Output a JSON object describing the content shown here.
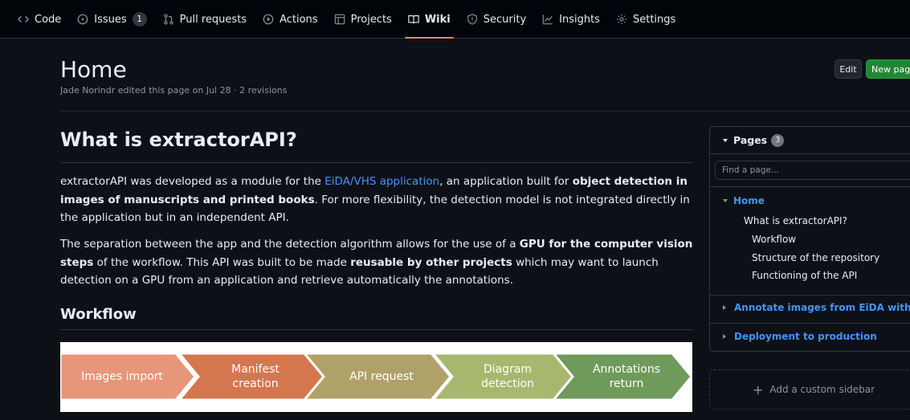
{
  "nav": {
    "tabs": [
      {
        "label": "Code",
        "icon": "code-icon"
      },
      {
        "label": "Issues",
        "icon": "issue-icon",
        "count": "1"
      },
      {
        "label": "Pull requests",
        "icon": "pull-request-icon"
      },
      {
        "label": "Actions",
        "icon": "play-icon"
      },
      {
        "label": "Projects",
        "icon": "table-icon"
      },
      {
        "label": "Wiki",
        "icon": "book-icon",
        "active": true
      },
      {
        "label": "Security",
        "icon": "shield-icon"
      },
      {
        "label": "Insights",
        "icon": "graph-icon"
      },
      {
        "label": "Settings",
        "icon": "gear-icon"
      }
    ]
  },
  "header": {
    "title": "Home",
    "meta": "Jade Norindr edited this page on Jul 28 · 2 revisions",
    "edit_label": "Edit",
    "new_page_label": "New page"
  },
  "article": {
    "h1": "What is extractorAPI?",
    "p1": {
      "t1": "extractorAPI was developed as a module for the ",
      "link": "EiDA/VHS application",
      "t2": ", an application built for ",
      "b1": "object detection in images of manuscripts and printed books",
      "t3": ". For more flexibility, the detection model is not integrated directly in the application but in an independent API."
    },
    "p2": {
      "t1": "The separation between the app and the detection algorithm allows for the use of a ",
      "b1": "GPU for the computer vision steps",
      "t2": " of the workflow. This API was built to be made ",
      "b2": "reusable by other projects",
      "t3": " which may want to launch detection on a GPU from an application and retrieve automatically the annotations."
    },
    "h2": "Workflow",
    "workflow": {
      "steps": [
        {
          "label": "Images import",
          "color": "#e8967a"
        },
        {
          "label": "Manifest creation",
          "color": "#d4774f"
        },
        {
          "label": "API request",
          "color": "#b0a169"
        },
        {
          "label": "Diagram detection",
          "color": "#a8b76e"
        },
        {
          "label": "Annotations return",
          "color": "#6f9a5b"
        }
      ]
    }
  },
  "sidebar": {
    "pages_label": "Pages",
    "pages_count": "3",
    "find_placeholder": "Find a page...",
    "home_label": "Home",
    "toc": [
      "What is extractorAPI?",
      "Workflow",
      "Structure of the repository",
      "Functioning of the API"
    ],
    "other_pages": [
      "Annotate images from EiDA with ...",
      "Deployment to production"
    ],
    "custom_sidebar_label": "Add a custom sidebar"
  }
}
